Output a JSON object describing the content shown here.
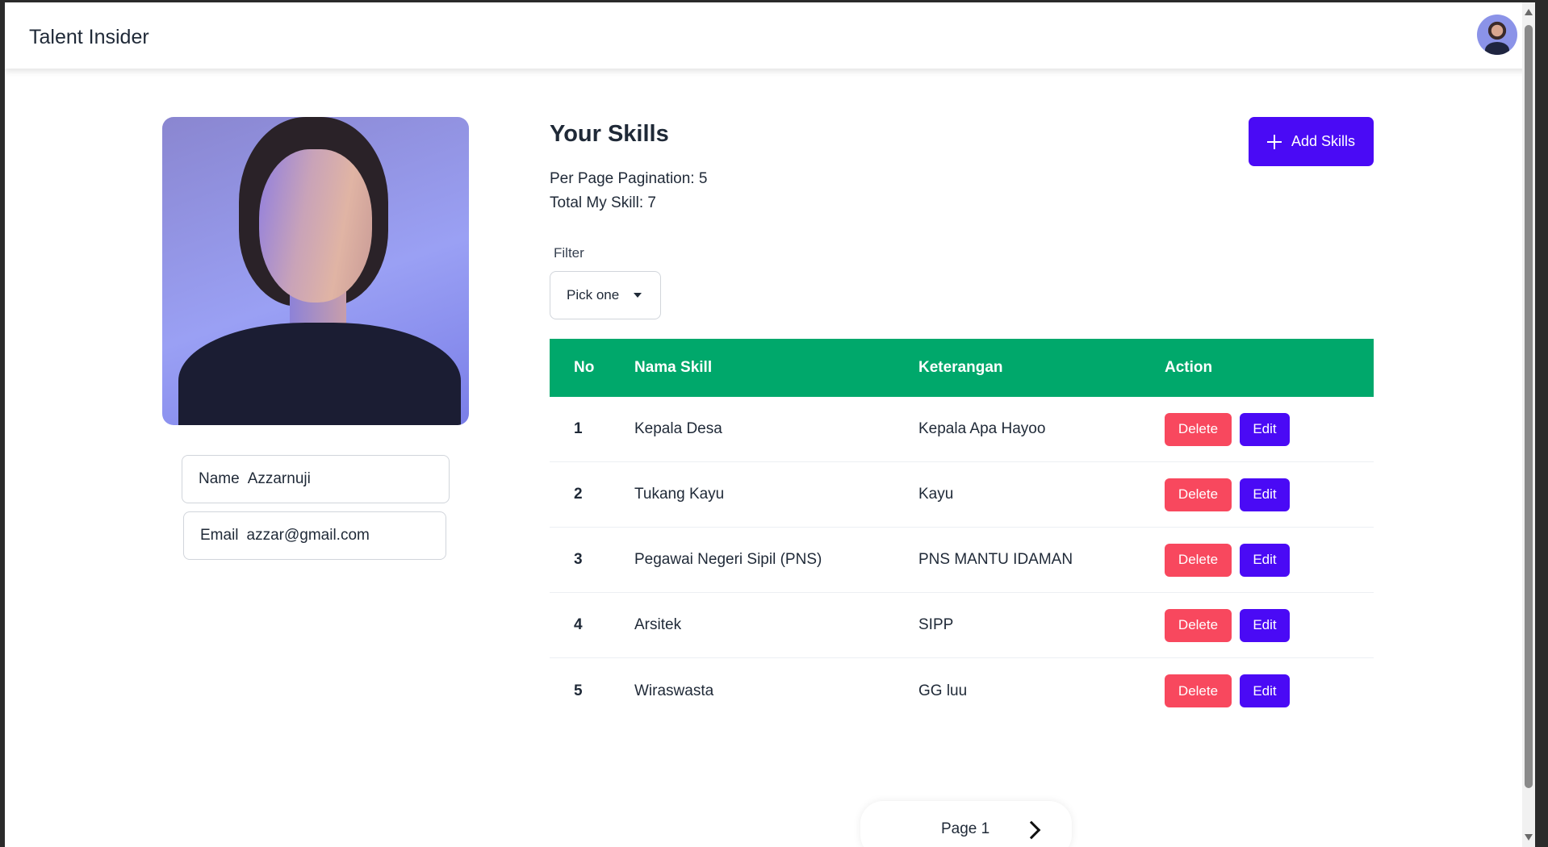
{
  "app": {
    "title": "Talent Insider"
  },
  "profile": {
    "name_label": "Name",
    "name_value": "Azzarnuji",
    "email_label": "Email",
    "email_value": "azzar@gmail.com"
  },
  "skills": {
    "title": "Your Skills",
    "per_page": "Per Page Pagination: 5",
    "total": "Total My Skill: 7",
    "add_label": "Add Skills",
    "filter_label": "Filter",
    "filter_value": "Pick one",
    "columns": [
      "No",
      "Nama Skill",
      "Keterangan",
      "Action"
    ],
    "rows": [
      {
        "no": "1",
        "name": "Kepala Desa",
        "ket": "Kepala Apa Hayoo"
      },
      {
        "no": "2",
        "name": "Tukang Kayu",
        "ket": "Kayu"
      },
      {
        "no": "3",
        "name": "Pegawai Negeri Sipil (PNS)",
        "ket": "PNS MANTU IDAMAN"
      },
      {
        "no": "4",
        "name": "Arsitek",
        "ket": "SIPP"
      },
      {
        "no": "5",
        "name": "Wiraswasta",
        "ket": "GG luu"
      }
    ],
    "delete_label": "Delete",
    "edit_label": "Edit"
  },
  "pagination": {
    "label": "Page 1"
  },
  "colors": {
    "accent": "#4a0af5",
    "header": "#00a86b",
    "danger": "#f8485e"
  }
}
